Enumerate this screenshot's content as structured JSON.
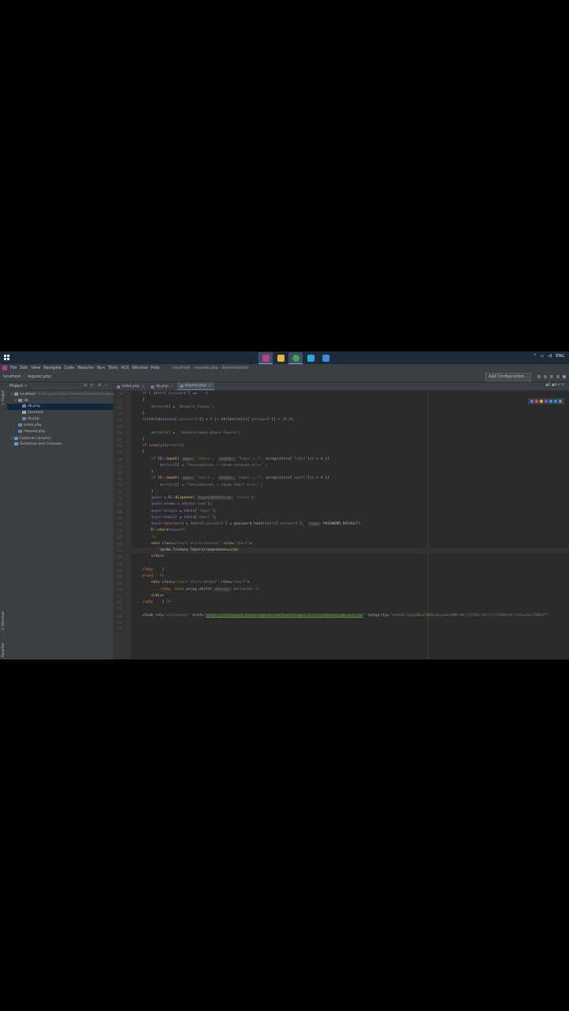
{
  "taskbar": {
    "apps": [
      {
        "name": "phpstorm-icon",
        "color": "#c0398c",
        "active": true
      },
      {
        "name": "file-explorer-icon",
        "color": "#e6b73b",
        "active": false
      },
      {
        "name": "chrome-icon",
        "color": "#3ba55c",
        "active": true
      },
      {
        "name": "telegram-icon",
        "color": "#2ca5e0",
        "active": false
      },
      {
        "name": "store-icon",
        "color": "#3c8be0",
        "active": false
      }
    ],
    "tray": {
      "chevron": "^",
      "lang": "ENG"
    }
  },
  "menu": {
    "items": [
      "File",
      "Edit",
      "View",
      "Navigate",
      "Code",
      "Refactor",
      "Run",
      "Tools",
      "VCS",
      "Window",
      "Help"
    ],
    "window_title": "localhost - request.php - Administrator"
  },
  "nav": {
    "crumbs": [
      "localhost",
      "request.php"
    ],
    "add_configuration": "Add Configuration..."
  },
  "project": {
    "header": "Project",
    "items": [
      {
        "label": "localhost",
        "sub": "D:\\Programs\\OpenServer\\domains\\localhost",
        "indent": 1,
        "type": "folder",
        "arrow": "▾",
        "selected": false
      },
      {
        "label": "db",
        "sub": "",
        "indent": 2,
        "type": "folder",
        "arrow": "▾",
        "selected": false
      },
      {
        "label": "db.php",
        "sub": "",
        "indent": 3,
        "type": "php",
        "arrow": "",
        "selected": true
      },
      {
        "label": "Scontact",
        "sub": "",
        "indent": 3,
        "type": "file",
        "arrow": "",
        "selected": false
      },
      {
        "label": "rb.php",
        "sub": "",
        "indent": 3,
        "type": "php",
        "arrow": "",
        "selected": false
      },
      {
        "label": "index.php",
        "sub": "",
        "indent": 2,
        "type": "php",
        "arrow": "",
        "selected": false
      },
      {
        "label": "request.php",
        "sub": "",
        "indent": 2,
        "type": "php",
        "arrow": "",
        "selected": false
      },
      {
        "label": "External Libraries",
        "sub": "",
        "indent": 1,
        "type": "lib",
        "arrow": "▸",
        "selected": false
      },
      {
        "label": "Scratches and Consoles",
        "sub": "",
        "indent": 1,
        "type": "scratch",
        "arrow": "",
        "selected": false
      }
    ]
  },
  "left_strip": {
    "top_label": "1: Project",
    "bottom_label": "2: Structure",
    "bottom2": "Favorites"
  },
  "editor": {
    "tabs": [
      {
        "label": "index.php",
        "active": false
      },
      {
        "label": "db.php",
        "active": false
      },
      {
        "label": "request.php",
        "active": true
      }
    ],
    "indicators": "▲2  ▲4  ∧  ∨",
    "browsers": [
      "#4285f4",
      "#e8453c",
      "#f4b400",
      "#7b4fd6",
      "#2aa1d8",
      "#3c8be0",
      "#34a0e6"
    ],
    "current_line_index": 24,
    "lines": [
      {
        "num": "20",
        "html": "<span class='kw'>if</span> ( <span class='var'>$data</span>[<span class='str'>'password'</span>] == <span class='str'>''</span> )"
      },
      {
        "num": "21",
        "html": "{"
      },
      {
        "num": "22",
        "html": "    <span class='var'>$errors</span>[] = <span class='str'>'Введите Пароль'</span>;"
      },
      {
        "num": "23",
        "html": "}"
      },
      {
        "num": "24",
        "html": "<span class='kw'>if</span>(strlen(<span class='var'>$data</span>[<span class='str'>'password'</span>]) &lt; <span class='num2'>5</span> || strlen(<span class='var'>$data</span>[<span class='str'>'password'</span>]) &gt; <span class='num2'>25</span> ){"
      },
      {
        "num": "25",
        "html": ""
      },
      {
        "num": "26",
        "html": "    <span class='var'>$errors</span>[] =  <span class='str'>'Недопустимая Длина Пароля'</span>;"
      },
      {
        "num": "27",
        "html": "}"
      },
      {
        "num": "28",
        "html": "<span class='kw'>if</span> (<span class='kw'>empty</span>(<span class='var'>$errors</span>))"
      },
      {
        "num": "29",
        "html": "{"
      },
      {
        "num": "30",
        "html": "    <span class='kw'>if</span> (R::<span class='fn'>count</span>( <span class='hint'>type:</span> <span class='str'>'users'</span>,  <span class='hint'>addSQL:</span> <span class='str'>\"login = ?\"</span>, array(<span class='var'>$data</span>[<span class='str'>'login'</span>])) &gt; <span class='num2'>0</span> ){"
      },
      {
        "num": "31",
        "html": "        <span class='var'>$errors</span>[] = <span class='str'>'Пользователь с таким логином есть!'</span>;"
      },
      {
        "num": "32",
        "html": "    }"
      },
      {
        "num": "33",
        "html": "    <span class='kw'>if</span> (R::<span class='fn'>count</span>( <span class='hint'>type:</span> <span class='str'>'users'</span>,  <span class='hint'>addSQL:</span> <span class='str'>\"email = ?\"</span>, array(<span class='var'>$data</span>[<span class='str'>'email'</span>])) &gt; <span class='num2'>0</span> ){"
      },
      {
        "num": "34",
        "html": "        <span class='var'>$errors</span>[] = <span class='str'>'Пользователь с таким Email есть!'</span>;"
      },
      {
        "num": "35",
        "html": "    }"
      },
      {
        "num": "36",
        "html": "    <span class='var'>$user</span> = R::<span class='fn'>dispense</span>( <span class='hint'>typeOrBeanArray:</span> <span class='str'>'users'</span>);"
      },
      {
        "num": "37",
        "html": "    <span class='var'>$user</span>-&gt;<span class='var'>name</span> = <span class='var'>$data</span>[<span class='str'>'name'</span>];"
      },
      {
        "num": "38",
        "html": "    <span class='var'>$user</span>-&gt;<span class='var'>login</span> = <span class='var'>$data</span>[<span class='str'>'login'</span>];"
      },
      {
        "num": "39",
        "html": "    <span class='var'>$user</span>-&gt;<span class='var'>email</span> = <span class='var'>$data</span>[<span class='str'>'email'</span>];"
      },
      {
        "num": "40",
        "html": "    <span class='var'>$user</span>-&gt;<span class='var'>password</span> = <span class='var'>$data</span>[<span class='str'>'password'</span>] = password_hash(<span class='var'>$data</span>[<span class='str'>'password'</span>],  <span class='hint'>algo:</span> PASSWORD_DEFAULT);"
      },
      {
        "num": "41",
        "html": "    R::<span class='fn'>store</span>(<span class='var'>$user</span>);"
      },
      {
        "num": "42",
        "html": "    <span class='kw'>?&gt;</span>"
      },
      {
        "num": "43",
        "html": "    <span class='tag'>&lt;div</span> class=<span class='str'>\"alert alert-success\"</span> role=<span class='str'>\"alert\"</span><span class='tag'>&gt;</span>"
      },
      {
        "num": "44",
        "html": "        <span class='tag'>&lt;p&gt;</span>Вы Успешно Зарегистрировались<span class='tag'>&lt;/p&gt;</span>"
      },
      {
        "num": "45",
        "html": "    <span class='tag'>&lt;/div&gt;</span>"
      },
      {
        "num": "46",
        "html": ""
      },
      {
        "num": "47",
        "html": "<span class='kw'>&lt;?php</span>    }"
      },
      {
        "num": "48",
        "html": "<span class='kw'>else</span>{   <span class='kw'>?&gt;</span>"
      },
      {
        "num": "49",
        "html": "    <span class='tag'>&lt;div</span> class=<span class='str'>\"alert alert-danger\"</span> role=<span class='str'>\"alert\"</span><span class='tag'>&gt;</span>"
      },
      {
        "num": "50",
        "html": "        <span class='kw'>&lt;?php</span>  <span class='kw'>echo</span> array_shift( <span class='hint'>&amp;array:</span> <span class='var'>$errors</span>); <span class='kw'>?&gt;</span>"
      },
      {
        "num": "51",
        "html": "    <span class='tag'>&lt;/div&gt;</span>"
      },
      {
        "num": "52",
        "html": "<span class='kw'>&lt;?php</span>    } <span class='kw'>?&gt;</span>"
      },
      {
        "num": "53",
        "html": ""
      },
      {
        "num": "54",
        "html": "<span class='tag'>&lt;link</span> rel=<span class='str'>\"stylesheet\"</span> href=<span class='str'>\"</span><span class='url'>https://stackpath.bootstrapcdn.com/bootstrap/4.3.1/css/bootstrap.min.css</span><span class='str'>\"</span> integrity=<span class='str'>\"sha384-ggOyR0iXCbMQv3Xipma34MD+dH/1fQ784/j6cY/iJTQUOhcWr7x9JvoRxT2MZw1T\"</span>"
      },
      {
        "num": "55",
        "html": ""
      },
      {
        "num": "56",
        "html": ""
      }
    ]
  }
}
